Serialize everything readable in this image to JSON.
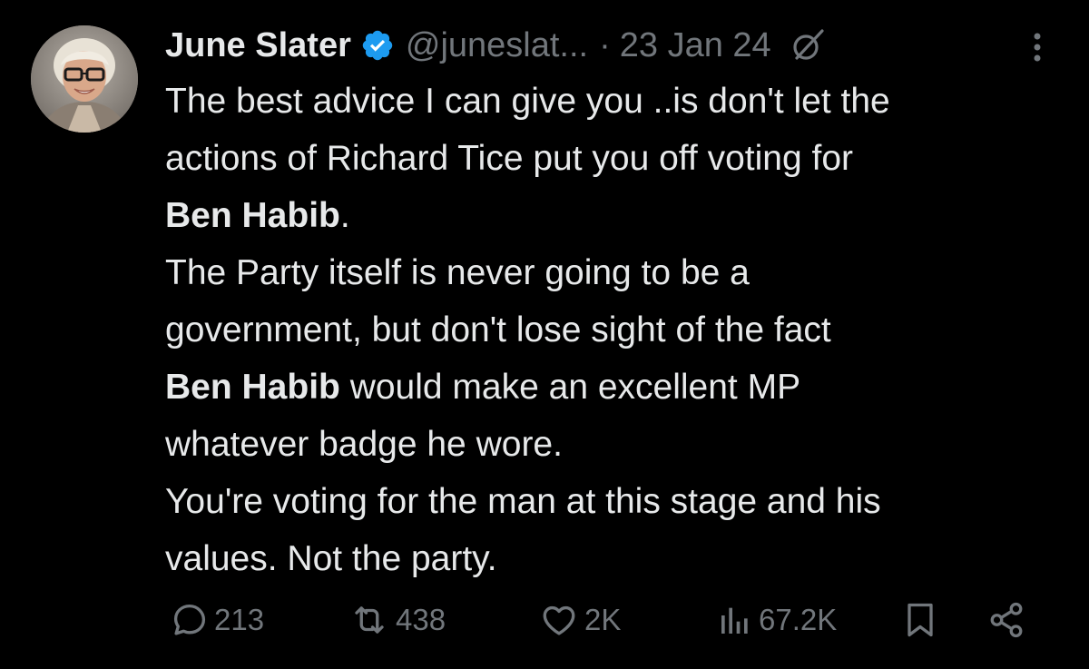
{
  "tweet": {
    "author_name": "June Slater",
    "handle": "@juneslat...",
    "separator": "·",
    "date": "23 Jan 24",
    "lines": [
      {
        "parts": [
          {
            "text": "The best advice I can give you ..is don't let the",
            "bold": false
          }
        ]
      },
      {
        "parts": [
          {
            "text": "actions of Richard Tice put you off voting for",
            "bold": false
          }
        ]
      },
      {
        "parts": [
          {
            "text": "Ben Habib",
            "bold": true
          },
          {
            "text": ".",
            "bold": false
          }
        ]
      },
      {
        "parts": [
          {
            "text": "The Party itself is never going to be a",
            "bold": false
          }
        ]
      },
      {
        "parts": [
          {
            "text": "government, but don't lose sight of the fact",
            "bold": false
          }
        ]
      },
      {
        "parts": [
          {
            "text": "Ben Habib",
            "bold": true
          },
          {
            "text": " would make an excellent MP",
            "bold": false
          }
        ]
      },
      {
        "parts": [
          {
            "text": "whatever badge he wore.",
            "bold": false
          }
        ]
      },
      {
        "parts": [
          {
            "text": "You're voting for the man at this stage and his",
            "bold": false
          }
        ]
      },
      {
        "parts": [
          {
            "text": "values. Not the party.",
            "bold": false
          }
        ]
      }
    ]
  },
  "actions": {
    "replies": "213",
    "reposts": "438",
    "likes": "2K",
    "views": "67.2K"
  },
  "icons": {
    "verified": "verified-badge-icon",
    "grok": "grok-icon",
    "more": "more-icon",
    "reply": "reply-icon",
    "repost": "repost-icon",
    "like": "heart-icon",
    "views": "views-icon",
    "bookmark": "bookmark-icon",
    "share": "share-icon"
  },
  "colors": {
    "background": "#000000",
    "text": "#e7e9ea",
    "muted": "#71767b",
    "verified": "#1d9bf0"
  }
}
